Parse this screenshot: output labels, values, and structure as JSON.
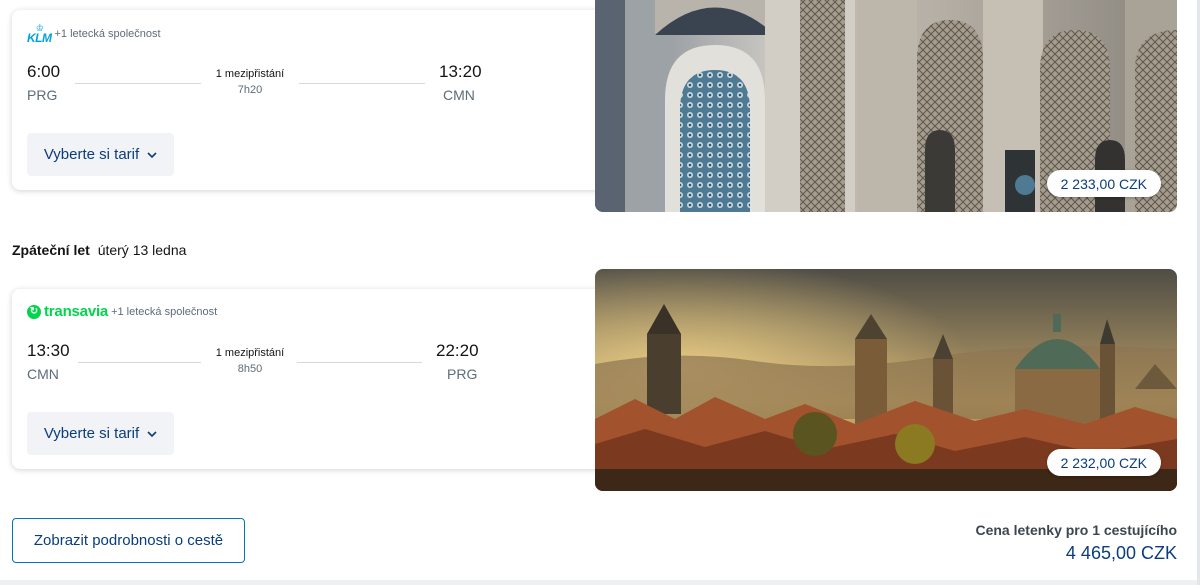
{
  "outbound": {
    "airline_logo": "KLM",
    "airline_more": "+1 letecká společnost",
    "depart_time": "6:00",
    "depart_code": "PRG",
    "arrive_time": "13:20",
    "arrive_code": "CMN",
    "stops": "1 mezipřistání",
    "duration": "7h20",
    "tarif_label": "Vyberte si tarif",
    "price": "2 233,00 CZK"
  },
  "return_header": {
    "label": "Zpáteční let",
    "date": "úterý 13 ledna"
  },
  "inbound": {
    "airline_logo": "transavia",
    "airline_more": "+1 letecká společnost",
    "depart_time": "13:30",
    "depart_code": "CMN",
    "arrive_time": "22:20",
    "arrive_code": "PRG",
    "stops": "1 mezipřistání",
    "duration": "8h50",
    "tarif_label": "Vyberte si tarif",
    "price": "2 232,00 CZK"
  },
  "footer": {
    "details_button": "Zobrazit podrobnosti o cestě",
    "total_label": "Cena letenky pro 1 cestujícího",
    "total_price": "4 465,00 CZK"
  },
  "icons": {
    "chevron": "chevron-down-icon",
    "klm": "klm-crown-icon",
    "transavia": "transavia-icon"
  },
  "colors": {
    "accent": "#0b3d7c",
    "klm_blue": "#00a1de",
    "transavia_green": "#00d54b"
  }
}
